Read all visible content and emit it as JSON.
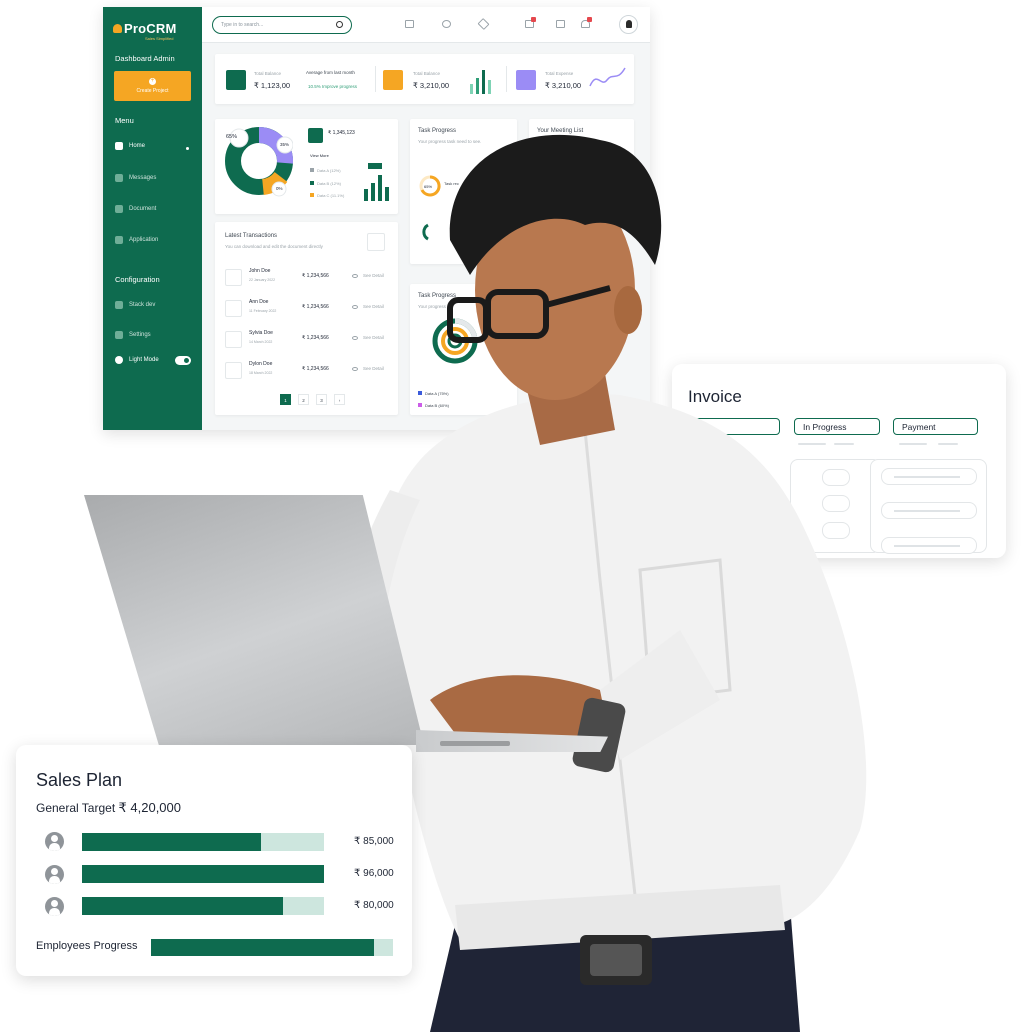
{
  "dashboard": {
    "logo": {
      "pre": "Pro",
      "main": "CRM",
      "tagline": "Sales Simplified"
    },
    "sidebar": {
      "section_top": "Dashboard Admin",
      "create_label": "Create Project",
      "menu_title": "Menu",
      "items": [
        {
          "label": "Home",
          "icon": "home-icon",
          "active": true
        },
        {
          "label": "Messages",
          "icon": "message-icon"
        },
        {
          "label": "Document",
          "icon": "document-icon"
        },
        {
          "label": "Application",
          "icon": "grid-icon"
        }
      ],
      "config_title": "Configuration",
      "config_items": [
        {
          "label": "Stack dev",
          "icon": "layers-icon"
        },
        {
          "label": "Settings",
          "icon": "gear-icon"
        },
        {
          "label": "Light Mode",
          "icon": "contrast-icon"
        }
      ]
    },
    "search": {
      "placeholder": "Type in to search..."
    },
    "stats": [
      {
        "label": "Total Balance",
        "value": "₹ 1,123,00",
        "color": "#0e6b4f"
      },
      {
        "label": "Average from last month",
        "value": "",
        "sub": "10.5%  Improve progress"
      },
      {
        "label": "Total Balance",
        "value": "₹ 3,210,00",
        "color": "#f5a623"
      },
      {
        "label": "Total Expense",
        "value": "₹ 3,210,00",
        "color": "#9b8cf5"
      }
    ],
    "donut": {
      "center_pct": "65%",
      "pct_right": "35%",
      "pct_bottom": "0%",
      "amount": "₹ 1,345,123",
      "view_more": "View More",
      "legend": [
        {
          "label": "Data A (12%)",
          "color": "#9aa3a9"
        },
        {
          "label": "Data B (12%)",
          "color": "#0e6b4f"
        },
        {
          "label": "Data C (11.1%)",
          "color": "#f5a623"
        }
      ]
    },
    "task_progress": {
      "title": "Task Progress",
      "sub": "Your progress task need to see.",
      "pct": "65%",
      "tag": "Task rec"
    },
    "meeting": {
      "title": "Your Meeting List"
    },
    "transactions": {
      "title": "Latest Transactions",
      "sub": "You can download and edit the document directly",
      "rows": [
        {
          "name": "John Doe",
          "date": "22 January 2022",
          "amount": "₹ 1,234,566",
          "action": "See Detail"
        },
        {
          "name": "Ann Doe",
          "date": "11 February 2022",
          "amount": "₹ 1,234,566",
          "action": "See Detail"
        },
        {
          "name": "Sylvia Doe",
          "date": "14 March 2022",
          "amount": "₹ 1,234,566",
          "action": "See Detail"
        },
        {
          "name": "Dylon Doe",
          "date": "18 March 2022",
          "amount": "₹ 1,234,566",
          "action": "See Detail"
        }
      ],
      "pages": [
        "1",
        "2",
        "3",
        "›"
      ]
    },
    "task_progress_2": {
      "title": "Task Progress",
      "sub": "Your progress",
      "legend": [
        {
          "label": "Data A (75%)",
          "color": "#3b5bdb"
        },
        {
          "label": "Data B (60%)",
          "color": "#cc5de8"
        }
      ]
    }
  },
  "invoice": {
    "title": "Invoice",
    "tabs": [
      "",
      "In Progress",
      "Payment"
    ]
  },
  "sales_plan": {
    "title": "Sales Plan",
    "target_label": "General Target",
    "target_value": "₹ 4,20,000",
    "rows": [
      {
        "amount": "₹ 85,000",
        "progress": 0.74
      },
      {
        "amount": "₹ 96,000",
        "progress": 1.0
      },
      {
        "amount": "₹ 80,000",
        "progress": 0.83
      }
    ],
    "employees_label": "Employees Progress",
    "employees_progress": 0.92
  },
  "colors": {
    "brand": "#0e6b4f",
    "accent": "#f5a623",
    "light_track": "#cde6de"
  }
}
